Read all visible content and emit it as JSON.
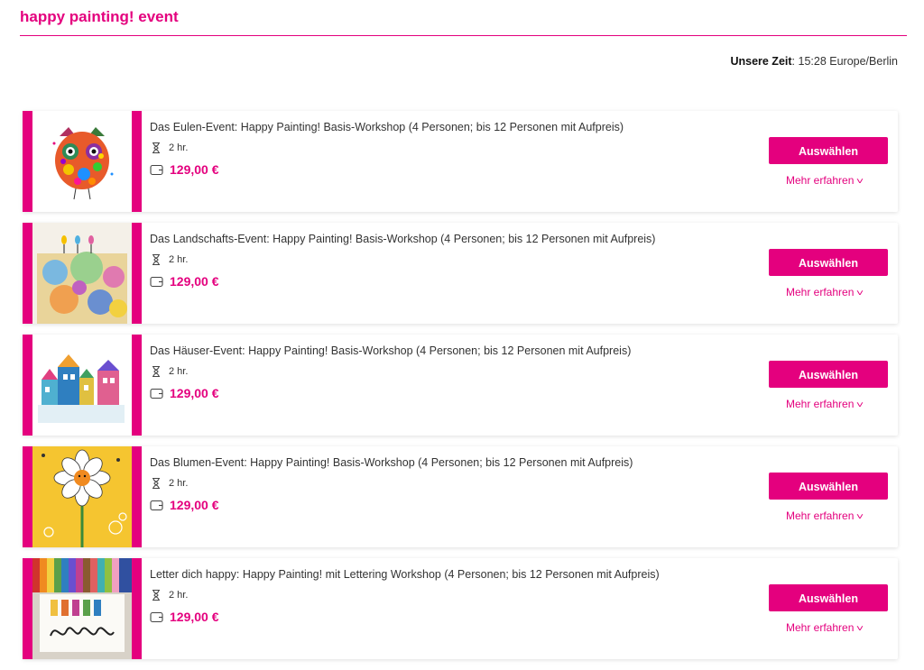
{
  "header": {
    "title": "happy painting! event"
  },
  "timezone": {
    "label": "Unsere Zeit",
    "value": "15:28 Europe/Berlin"
  },
  "icons": {
    "duration": "hourglass-icon",
    "price": "wallet-icon",
    "expand": "chevron-down-icon"
  },
  "colors": {
    "accent": "#e4007e"
  },
  "events": [
    {
      "title": "Das Eulen-Event: Happy Painting! Basis-Workshop (4 Personen; bis 12 Personen mit Aufpreis)",
      "duration": "2 hr.",
      "price": "129,00 €",
      "select_label": "Auswählen",
      "more_label": "Mehr erfahren"
    },
    {
      "title": "Das Landschafts-Event: Happy Painting! Basis-Workshop (4 Personen; bis 12 Personen mit Aufpreis)",
      "duration": "2 hr.",
      "price": "129,00 €",
      "select_label": "Auswählen",
      "more_label": "Mehr erfahren"
    },
    {
      "title": "Das Häuser-Event: Happy Painting! Basis-Workshop (4 Personen; bis 12 Personen mit Aufpreis)",
      "duration": "2 hr.",
      "price": "129,00 €",
      "select_label": "Auswählen",
      "more_label": "Mehr erfahren"
    },
    {
      "title": "Das Blumen-Event: Happy Painting! Basis-Workshop (4 Personen; bis 12 Personen mit Aufpreis)",
      "duration": "2 hr.",
      "price": "129,00 €",
      "select_label": "Auswählen",
      "more_label": "Mehr erfahren"
    },
    {
      "title": "Letter dich happy: Happy Painting! mit Lettering Workshop (4 Personen; bis 12 Personen mit Aufpreis)",
      "duration": "2 hr.",
      "price": "129,00 €",
      "select_label": "Auswählen",
      "more_label": "Mehr erfahren"
    }
  ]
}
